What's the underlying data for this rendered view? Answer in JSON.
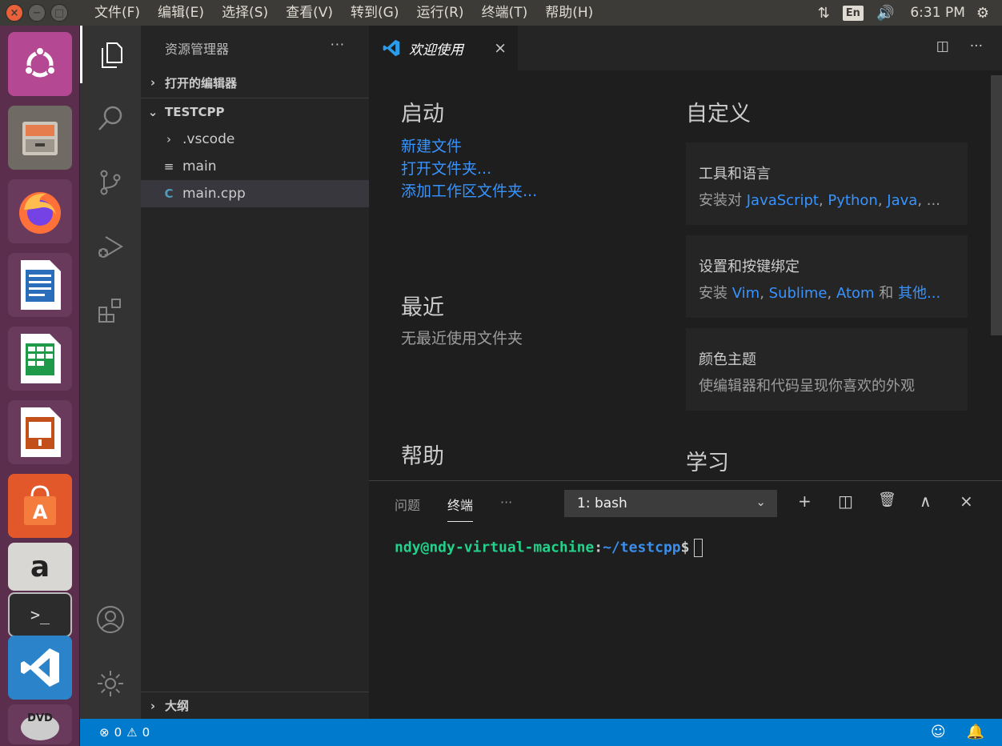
{
  "topbar": {
    "menus": [
      "文件(F)",
      "编辑(E)",
      "选择(S)",
      "查看(V)",
      "转到(G)",
      "运行(R)",
      "终端(T)",
      "帮助(H)"
    ],
    "window_controls": {
      "close": "×",
      "minimize": "−",
      "maximize": "□"
    },
    "tray": {
      "network_icon": "⇅",
      "lang": "En",
      "volume_icon": "🔊",
      "time": "6:31 PM",
      "settings_icon": "⚙"
    }
  },
  "launcher": {
    "apps": [
      "ubuntu-dash",
      "files",
      "firefox",
      "writer",
      "calc",
      "impress",
      "software-center",
      "amazon",
      "terminal",
      "vscode",
      "dvd"
    ]
  },
  "sidebar": {
    "title": "资源管理器",
    "more": "···",
    "open_editors": "打开的编辑器",
    "project": "TESTCPP",
    "items": [
      {
        "icon": "›",
        "label": ".vscode"
      },
      {
        "icon": "≡",
        "label": "main"
      },
      {
        "icon": "C",
        "label": "main.cpp"
      }
    ],
    "outline": "大纲"
  },
  "tab": {
    "label": "欢迎使用",
    "close": "×"
  },
  "welcome": {
    "start": {
      "heading": "启动",
      "links": [
        "新建文件",
        "打开文件夹...",
        "添加工作区文件夹..."
      ]
    },
    "recent": {
      "heading": "最近",
      "empty": "无最近使用文件夹"
    },
    "help": {
      "heading": "帮助"
    },
    "customize": {
      "heading": "自定义",
      "cards": [
        {
          "title": "工具和语言",
          "prefix": "安装对 ",
          "highlights": [
            "JavaScript",
            "Python",
            "Java"
          ],
          "seps": [
            ", ",
            ", ",
            ", ..."
          ],
          "suffix": ""
        },
        {
          "title": "设置和按键绑定",
          "prefix": "安装 ",
          "highlights": [
            "Vim",
            "Sublime",
            "Atom"
          ],
          "seps": [
            ", ",
            ", ",
            " 和 "
          ],
          "suffix": "其他..."
        },
        {
          "title": "颜色主题",
          "desc": "使编辑器和代码呈现你喜欢的外观"
        }
      ]
    },
    "learn": {
      "heading": "学习"
    }
  },
  "panel": {
    "tabs": [
      "问题",
      "终端",
      "···"
    ],
    "terminal_select": "1: bash",
    "actions": [
      "+",
      "◫",
      "🗑",
      "∧",
      "×"
    ],
    "prompt": {
      "user": "ndy@ndy-virtual-machine",
      "sep": ":",
      "path": "~/testcpp",
      "dollar": "$"
    }
  },
  "statusbar": {
    "errors": "0",
    "warnings": "0",
    "error_icon": "⊗",
    "warning_icon": "⚠",
    "feedback_icon": "☺",
    "bell_icon": "🔔"
  },
  "colors": {
    "accent": "#007acc",
    "link": "#3794ff",
    "launcher": "#5b2e4d"
  }
}
